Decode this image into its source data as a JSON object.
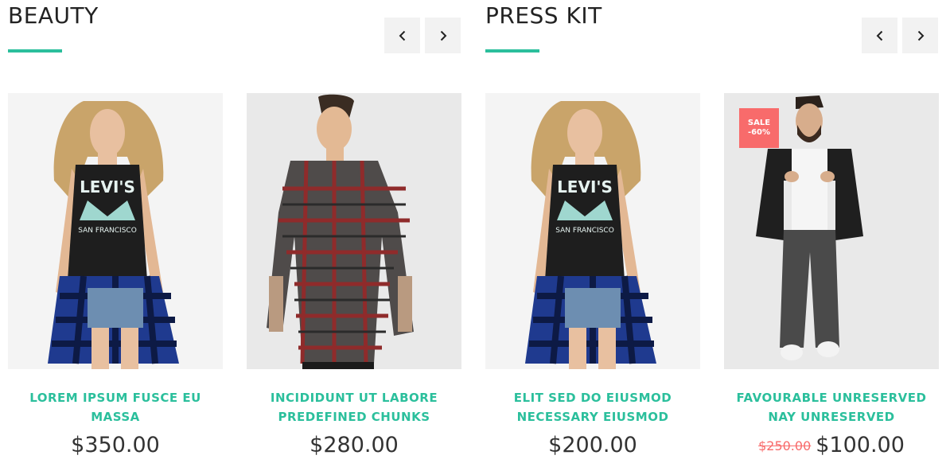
{
  "sections": [
    {
      "title": "BEAUTY",
      "products": [
        {
          "name": "LOREM IPSUM FUSCE EU MASSA",
          "price": "$350.00"
        },
        {
          "name": "INCIDIDUNT UT LABORE PREDEFINED CHUNKS",
          "price": "$280.00"
        }
      ]
    },
    {
      "title": "PRESS KIT",
      "products": [
        {
          "name": "ELIT SED DO EIUSMOD NECESSARY EIUSMOD",
          "price": "$200.00"
        },
        {
          "name": "FAVOURABLE UNRESERVED NAY UNRESERVED",
          "old_price": "$250.00",
          "price": "$100.00",
          "badge_line1": "SALE",
          "badge_line2": "-60%"
        }
      ]
    }
  ],
  "colors": {
    "accent": "#2bbf9c",
    "sale": "#f86b6b",
    "price": "#333333"
  },
  "icons": {
    "prev": "chevron-left-icon",
    "next": "chevron-right-icon"
  }
}
